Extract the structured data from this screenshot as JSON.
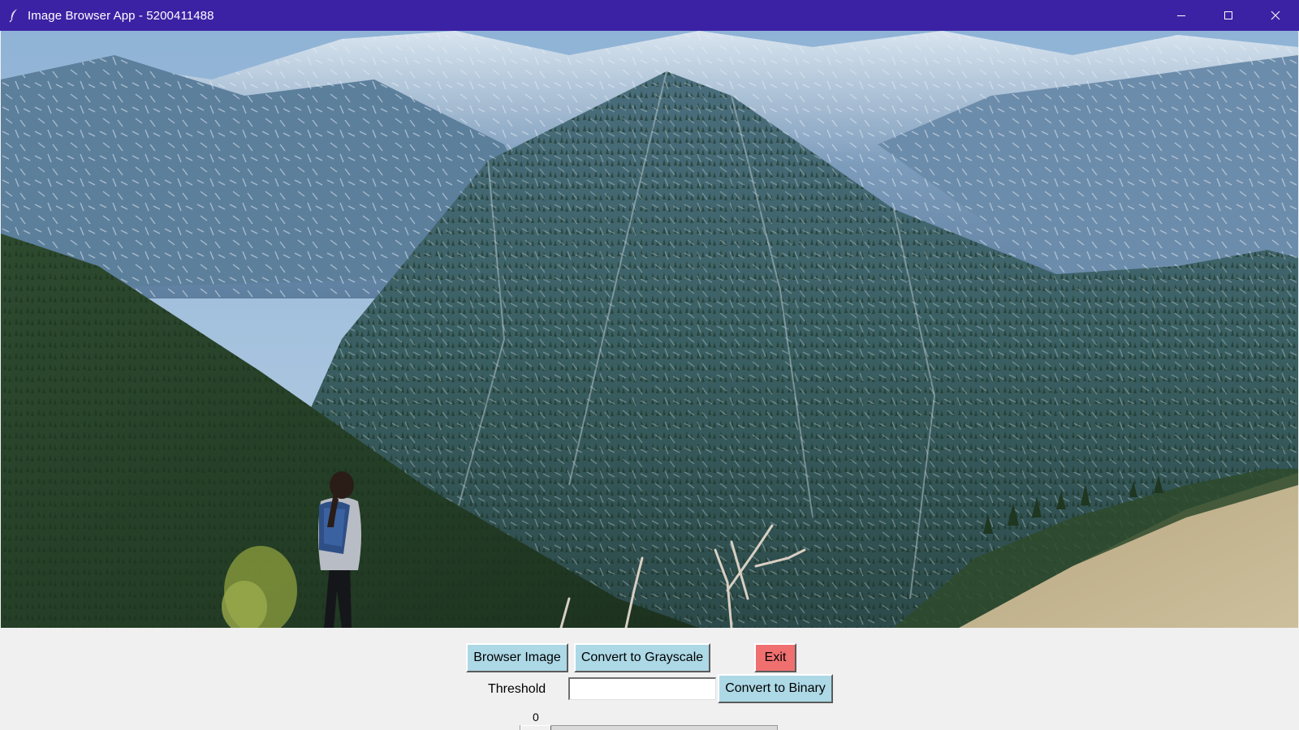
{
  "window": {
    "title": "Image Browser App - 5200411488",
    "titlebar_color": "#3b22a4",
    "icon": "feather-icon",
    "controls": [
      "minimize-icon",
      "maximize-icon",
      "close-icon"
    ]
  },
  "image": {
    "alt": "mountain landscape with hiker",
    "icon": "photo-landscape"
  },
  "toolbar": {
    "browse_label": "Browser Image",
    "grayscale_label": "Convert to Grayscale",
    "exit_label": "Exit",
    "threshold_label": "Threshold",
    "threshold_value": "",
    "binary_label": "Convert to Binary",
    "button_color": "#add8e6",
    "exit_color": "#f07070"
  },
  "slider": {
    "value": "0",
    "fraction": 0
  }
}
